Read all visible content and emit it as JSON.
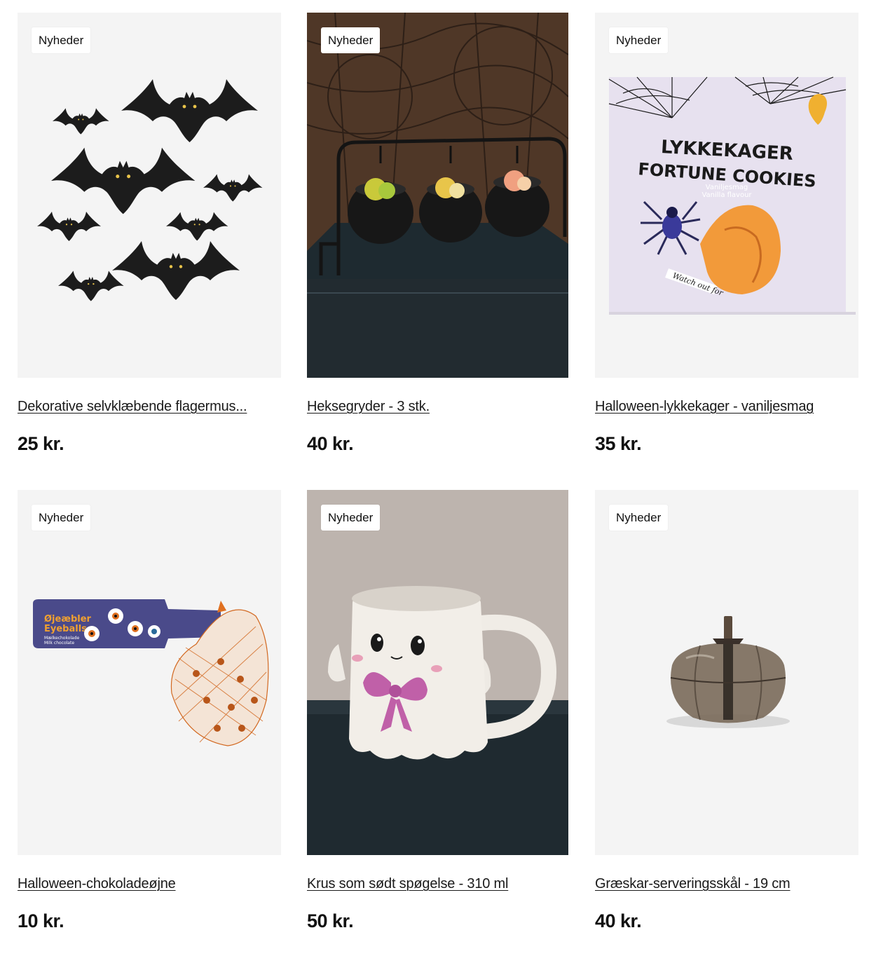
{
  "products": [
    {
      "badge": "Nyheder",
      "title": "Dekorative selvklæbende flagermus...",
      "price": "25 kr.",
      "image": "bats-decoration"
    },
    {
      "badge": "Nyheder",
      "title": "Heksegryder - 3 stk.",
      "price": "40 kr.",
      "image": "witch-cauldrons"
    },
    {
      "badge": "Nyheder",
      "title": "Halloween-lykkekager - vaniljesmag",
      "price": "35 kr.",
      "image": "fortune-cookies-box",
      "packaging_text": [
        "LYKKEKAGER",
        "FORTUNE COOKIES",
        "Vaniljesmag",
        "Vanilla flavour",
        "Watch out for"
      ]
    },
    {
      "badge": "Nyheder",
      "title": "Halloween-chokoladeøjne",
      "price": "10 kr.",
      "image": "chocolate-eyeballs",
      "packaging_text": [
        "Øjeæbler",
        "Eyeballs",
        "Mælkechokolade",
        "Milk chocolate"
      ]
    },
    {
      "badge": "Nyheder",
      "title": "Krus som sødt spøgelse - 310 ml",
      "price": "50 kr.",
      "image": "ghost-mug"
    },
    {
      "badge": "Nyheder",
      "title": "Græskar-serveringsskål - 19 cm",
      "price": "40 kr.",
      "image": "pumpkin-bowl"
    }
  ],
  "colors": {
    "card_bg": "#f4f4f4",
    "text": "#1a1a1a",
    "badge_bg": "#ffffff"
  }
}
